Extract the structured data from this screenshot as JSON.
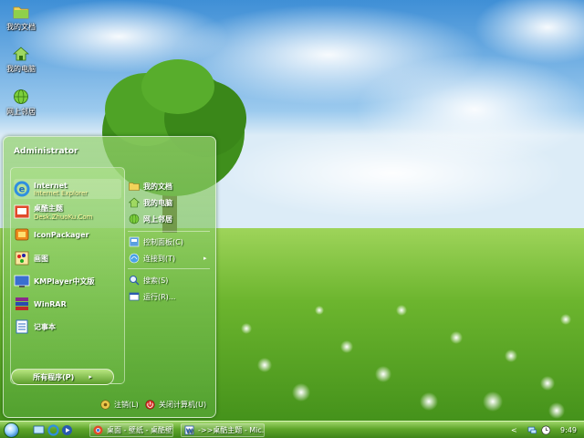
{
  "desktop": {
    "icons": [
      {
        "label": "我的文档",
        "icon": "folder-icon"
      },
      {
        "label": "我的电脑",
        "icon": "house-icon"
      },
      {
        "label": "网上邻居",
        "icon": "globe-icon"
      }
    ]
  },
  "start_menu": {
    "user": "Administrator",
    "pinned": [
      {
        "name": "Internet",
        "sub": "Internet Explorer",
        "icon": "ie-icon"
      },
      {
        "name": "桌酷主题",
        "sub": "Desk.ZhuoKu.Com",
        "icon": "theme-icon"
      }
    ],
    "programs": [
      {
        "name": "IconPackager",
        "icon": "iconpackager-icon"
      },
      {
        "name": "画图",
        "icon": "paint-icon"
      },
      {
        "name": "KMPlayer中文版",
        "icon": "kmplayer-icon"
      },
      {
        "name": "WinRAR",
        "icon": "winrar-icon"
      },
      {
        "name": "记事本",
        "icon": "notepad-icon"
      }
    ],
    "all_programs": "所有程序(P)",
    "all_programs_arrow": "▸",
    "places": [
      {
        "label": "我的文档",
        "icon": "folder-icon"
      },
      {
        "label": "我的电脑",
        "icon": "computer-icon"
      },
      {
        "label": "网上邻居",
        "icon": "network-icon"
      }
    ],
    "system": [
      {
        "label": "控制面板(C)",
        "icon": "control-panel-icon"
      },
      {
        "label": "连接到(T)",
        "icon": "connect-icon"
      }
    ],
    "tools": [
      {
        "label": "搜索(S)",
        "icon": "search-icon"
      },
      {
        "label": "运行(R)...",
        "icon": "run-icon"
      }
    ],
    "submenu_arrow": "▸",
    "logoff": "注销(L)",
    "shutdown": "关闭计算机(U)"
  },
  "taskbar": {
    "buttons": [
      {
        "label": "桌面 - 壁纸 - 桌酷壁...",
        "icon": "chrome-icon"
      },
      {
        "label": "->>桌酷主题 - Mic...",
        "icon": "word-icon"
      }
    ],
    "tray_expand": "<",
    "clock": "9:49"
  },
  "colors": {
    "accent": "#5fa62b",
    "sky": "#7fb6e6",
    "grass": "#6bb830"
  }
}
